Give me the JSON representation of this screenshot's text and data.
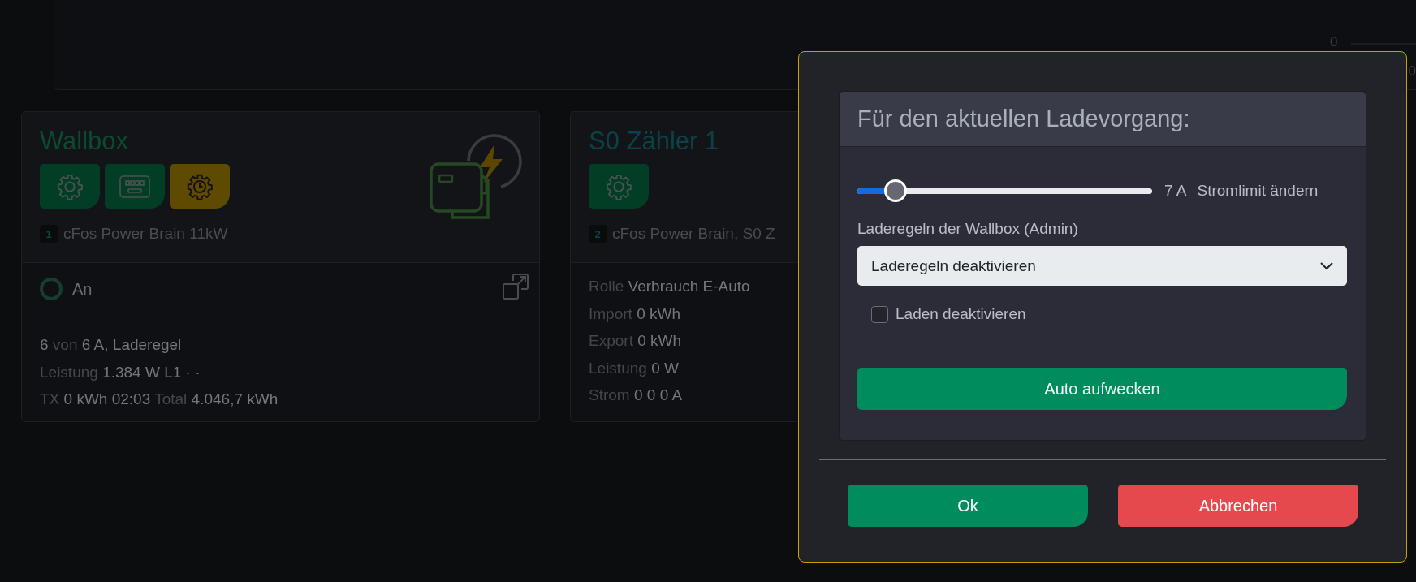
{
  "background_panel": {
    "axis_labels": [
      "0",
      "0"
    ]
  },
  "cards": [
    {
      "kind": "wallbox",
      "title": "Wallbox",
      "color": "#0b4a30",
      "actions": [
        {
          "kind": "settings",
          "color": "#023d25"
        },
        {
          "kind": "meter",
          "color": "#023d25"
        },
        {
          "kind": "schedule",
          "color": "#5e4a00"
        }
      ],
      "index": "1",
      "model": "cFos Power Brain 11kW",
      "status": "An",
      "lines": [
        [
          {
            "text": "6",
            "kind": "value"
          },
          {
            "text": "von",
            "kind": "label"
          },
          {
            "text": "6 A, Laderegel",
            "kind": "value"
          }
        ],
        [
          {
            "text": "Leistung",
            "kind": "label"
          },
          {
            "text": "1.384 W L1 · ·",
            "kind": "value"
          }
        ],
        [
          {
            "text": "TX",
            "kind": "label"
          },
          {
            "text": "0 kWh 02:03",
            "kind": "value"
          },
          {
            "text": "Total",
            "kind": "label"
          },
          {
            "text": "4.046,7 kWh",
            "kind": "value"
          }
        ]
      ]
    },
    {
      "kind": "meter",
      "title": "S0 Zähler 1",
      "color": "#0b4148",
      "actions": [
        {
          "kind": "settings",
          "color": "#023d25"
        }
      ],
      "index": "2",
      "model": "cFos Power Brain, S0 Z",
      "lines": [
        [
          {
            "text": "Rolle",
            "kind": "label"
          },
          {
            "text": "Verbrauch E-Auto",
            "kind": "value"
          }
        ],
        [
          {
            "text": "Import",
            "kind": "label"
          },
          {
            "text": "0 kWh",
            "kind": "value"
          }
        ],
        [
          {
            "text": "Export",
            "kind": "label"
          },
          {
            "text": "0 kWh",
            "kind": "value"
          }
        ],
        [
          {
            "text": "Leistung",
            "kind": "label"
          },
          {
            "text": "0 W",
            "kind": "value"
          }
        ],
        [
          {
            "text": "Strom",
            "kind": "label"
          },
          {
            "text": "0 0 0 A",
            "kind": "value"
          }
        ]
      ]
    }
  ],
  "dialog": {
    "section_title": "Für den aktuellen Ladevorgang:",
    "slider": {
      "level": 0.13,
      "reading": "7 A",
      "label": "Stromlimit ändern"
    },
    "select": {
      "label": "Laderegeln der Wallbox (Admin)",
      "value": "Laderegeln deaktivieren"
    },
    "checkbox": {
      "label": "Laden deaktivieren",
      "checked": false
    },
    "wake_button": "Auto aufwecken",
    "buttons": [
      {
        "label": "Ok",
        "kind": "confirm"
      },
      {
        "label": "Abbrechen",
        "kind": "cancel"
      }
    ]
  }
}
